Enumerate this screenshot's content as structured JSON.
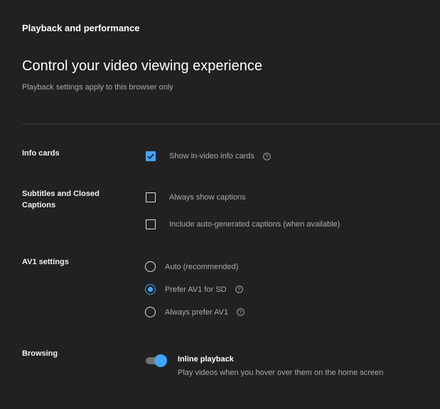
{
  "header": {
    "section_label": "Playback and performance",
    "title": "Control your video viewing experience",
    "subtitle": "Playback settings apply to this browser only"
  },
  "info_cards": {
    "label": "Info cards",
    "option": {
      "label": "Show in-video info cards",
      "checked": true,
      "help_icon": "question-circle-icon"
    }
  },
  "captions": {
    "label": "Subtitles and Closed Captions",
    "options": [
      {
        "label": "Always show captions",
        "checked": false
      },
      {
        "label": "Include auto-generated captions (when available)",
        "checked": false
      }
    ]
  },
  "av1": {
    "label": "AV1 settings",
    "options": [
      {
        "label": "Auto (recommended)",
        "selected": false
      },
      {
        "label": "Prefer AV1 for SD",
        "selected": true,
        "help_icon": "question-circle-icon"
      },
      {
        "label": "Always prefer AV1",
        "selected": false,
        "help_icon": "question-circle-icon"
      }
    ]
  },
  "browsing": {
    "label": "Browsing",
    "toggle": {
      "title": "Inline playback",
      "description": "Play videos when you hover over them on the home screen",
      "on": true
    }
  },
  "colors": {
    "background": "#212121",
    "accent": "#3ea6ff",
    "text_primary": "#f1f1f1",
    "text_secondary": "#aaaaaa"
  }
}
